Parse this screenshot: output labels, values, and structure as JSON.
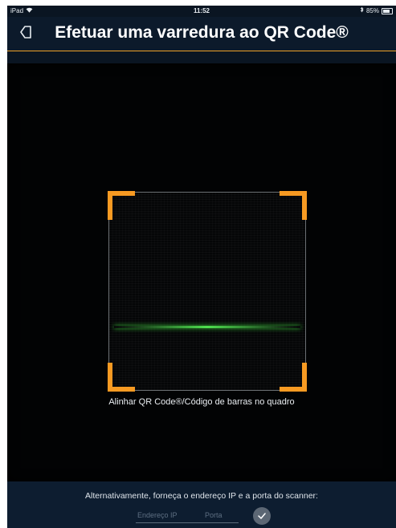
{
  "status_bar": {
    "carrier": "iPad",
    "wifi_icon": "wifi-icon",
    "time": "11:52",
    "bluetooth_icon": "bluetooth-icon",
    "battery_level": "85%",
    "battery_icon": "battery-icon"
  },
  "header": {
    "title": "Efetuar uma varredura ao QR Code®",
    "back_icon": "back-arrow-icon",
    "accent_color": "#f0a126"
  },
  "scanner": {
    "hint": "Alinhar QR Code®/Código de barras no quadro",
    "frame_corner_color": "#f79a22",
    "scan_line_color": "#4fe04f"
  },
  "footer": {
    "prompt": "Alternativamente, forneça o endereço IP e a porta do scanner:",
    "ip_placeholder": "Endereço IP",
    "ip_value": "",
    "port_placeholder": "Porta",
    "port_value": "",
    "confirm_icon": "checkmark-icon"
  }
}
